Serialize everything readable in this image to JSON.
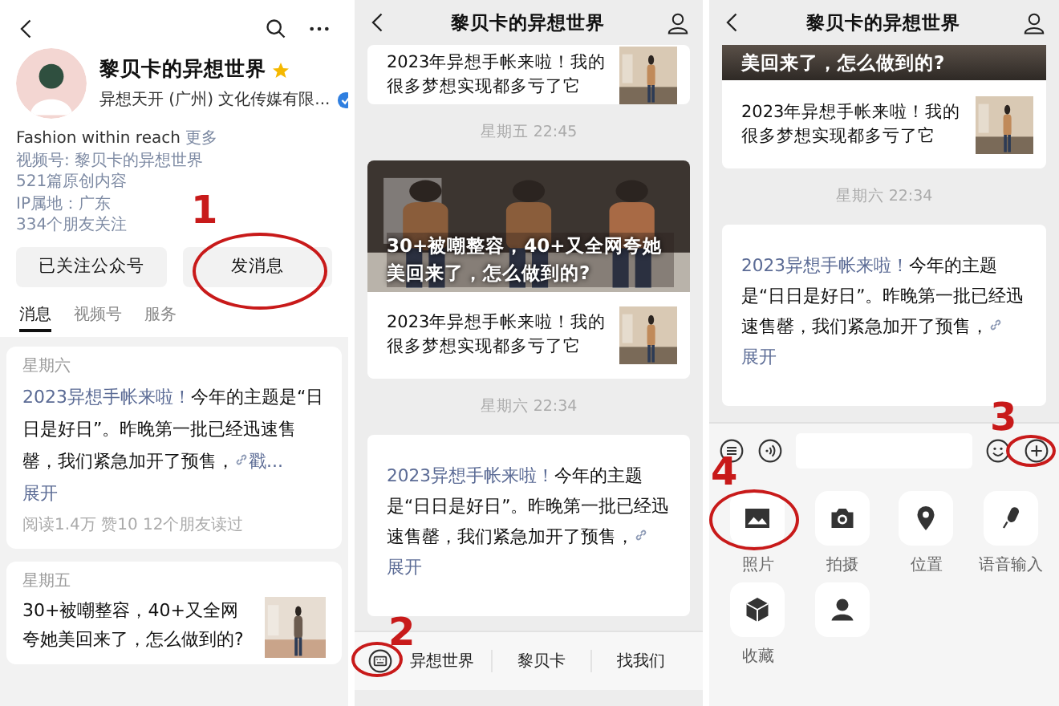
{
  "profile": {
    "account_name": "黎贝卡的异想世界",
    "company": "异想天开 (广州) 文化传媒有限...",
    "bio": "Fashion within reach",
    "more": "更多",
    "channel": "视频号: 黎贝卡的异想世界",
    "originals": "521篇原创内容",
    "ip": "IP属地：广东",
    "friends": "334个朋友关注",
    "buttons": [
      "已关注公众号",
      "发消息"
    ],
    "tabs": [
      {
        "label": "消息",
        "selected": true
      },
      {
        "label": "视频号",
        "selected": false
      },
      {
        "label": "服务",
        "selected": false
      }
    ],
    "posts": [
      {
        "kind": "text",
        "day": "星期六",
        "lead": "2023异想手帐来啦！",
        "body": "今年的主题是“日日是好日”。昨晚第一批已经迅速售罄，我们紧急加开了预售，",
        "more": "戳...",
        "expand": "展开",
        "stats": "阅读1.4万 赞10 12个朋友读过"
      },
      {
        "kind": "article",
        "day": "星期五",
        "title": "30+被嘲整容，40+又全网夸她美回来了，怎么做到的?"
      }
    ]
  },
  "chats": [
    {
      "title": "黎贝卡的异想世界",
      "messages": [
        {
          "kind": "link_card",
          "text": "2023年异想手帐来啦！我的很多梦想实现都多亏了它"
        },
        {
          "kind": "time",
          "text": "星期五 22:45"
        },
        {
          "kind": "article",
          "title": "30+被嘲整容，40+又全网夸她美回来了，怎么做到的?",
          "sub": "2023年异想手帐来啦！我的很多梦想实现都多亏了它"
        },
        {
          "kind": "time",
          "text": "星期六 22:34"
        },
        {
          "kind": "text",
          "lead": "2023异想手帐来啦！",
          "body": "今年的主题是“日日是好日”。昨晚第一批已经迅速售罄，我们紧急加开了预售，",
          "expand": "展开"
        }
      ],
      "menu": [
        "异想世界",
        "黎贝卡",
        "找我们"
      ]
    },
    {
      "title": "黎贝卡的异想世界",
      "messages": [
        {
          "kind": "banner",
          "title": "美回来了，怎么做到的?"
        },
        {
          "kind": "link_card",
          "text": "2023年异想手帐来啦！我的很多梦想实现都多亏了它"
        },
        {
          "kind": "time",
          "text": "星期六 22:34"
        },
        {
          "kind": "text",
          "lead": "2023异想手帐来啦！",
          "body": "今年的主题是“日日是好日”。昨晚第一批已经迅速售罄，我们紧急加开了预售，",
          "expand": "展开"
        }
      ],
      "tools": [
        {
          "label": "照片"
        },
        {
          "kind": "camera",
          "label": "拍摄"
        },
        {
          "kind": "location",
          "label": "位置"
        },
        {
          "kind": "voice",
          "label": "语音输入"
        },
        {
          "kind": "favorites",
          "label": "收藏"
        },
        {
          "kind": "contact"
        }
      ]
    }
  ],
  "annotations": [
    {
      "label": "1"
    },
    {
      "label": "2"
    },
    {
      "label": "3"
    },
    {
      "label": "4"
    }
  ]
}
